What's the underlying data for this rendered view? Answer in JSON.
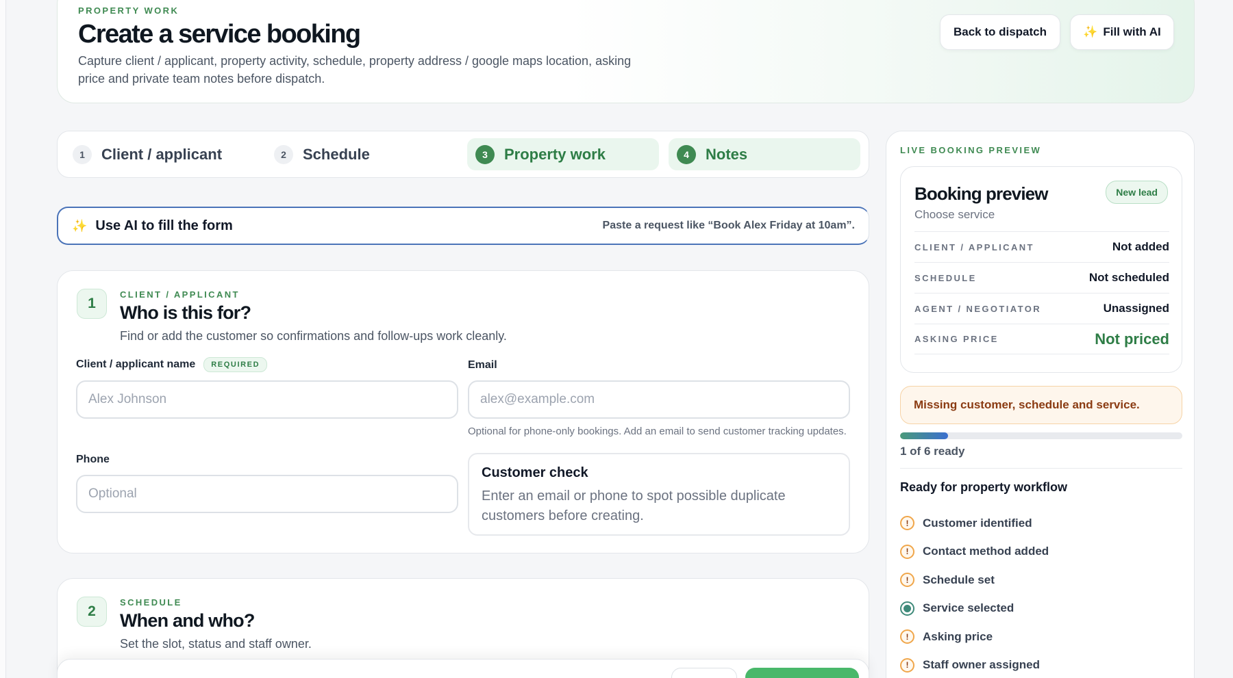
{
  "header": {
    "eyebrow": "PROPERTY WORK",
    "title": "Create a service booking",
    "description": "Capture client / applicant, property activity, schedule, property address / google maps location, asking price and private team notes before dispatch.",
    "back_label": "Back to dispatch",
    "ai_label": "Fill with AI"
  },
  "steps": [
    {
      "num": "1",
      "label": "Client / applicant",
      "active": false
    },
    {
      "num": "2",
      "label": "Schedule",
      "active": false
    },
    {
      "num": "3",
      "label": "Property work",
      "active": true
    },
    {
      "num": "4",
      "label": "Notes",
      "active": true
    }
  ],
  "ai_bar": {
    "title": "Use AI to fill the form",
    "hint": "Paste a request like “Book Alex Friday at 10am”."
  },
  "section1": {
    "num": "1",
    "eyebrow": "CLIENT / APPLICANT",
    "title": "Who is this for?",
    "subtitle": "Find or add the customer so confirmations and follow-ups work cleanly.",
    "name_label": "Client / applicant name",
    "required_label": "REQUIRED",
    "name_placeholder": "Alex Johnson",
    "email_label": "Email",
    "email_placeholder": "alex@example.com",
    "email_help": "Optional for phone-only bookings. Add an email to send customer tracking updates.",
    "phone_label": "Phone",
    "phone_placeholder": "Optional",
    "check_title": "Customer check",
    "check_desc": "Enter an email or phone to spot possible duplicate customers before creating."
  },
  "section2": {
    "num": "2",
    "eyebrow": "SCHEDULE",
    "title": "When and who?",
    "subtitle": "Set the slot, status and staff owner."
  },
  "sidebar": {
    "eyebrow": "LIVE BOOKING PREVIEW",
    "preview_title": "Booking preview",
    "preview_sub": "Choose service",
    "badge": "New lead",
    "rows": [
      {
        "key": "CLIENT / APPLICANT",
        "value": "Not added"
      },
      {
        "key": "SCHEDULE",
        "value": "Not scheduled"
      },
      {
        "key": "AGENT / NEGOTIATOR",
        "value": "Unassigned"
      },
      {
        "key": "ASKING PRICE",
        "value": "Not priced"
      }
    ],
    "warning": "Missing customer, schedule and service.",
    "progress": 0.17,
    "ready_text": "1 of 6 ready",
    "workflow_title": "Ready for property workflow",
    "checklist": [
      {
        "label": "Customer identified",
        "done": false
      },
      {
        "label": "Contact method added",
        "done": false
      },
      {
        "label": "Schedule set",
        "done": false
      },
      {
        "label": "Service selected",
        "done": true
      },
      {
        "label": "Asking price",
        "done": false
      },
      {
        "label": "Staff owner assigned",
        "done": false
      }
    ]
  },
  "colors": {
    "accent": "#3f8a52",
    "warning_bg": "#fef6ec",
    "warning_text": "#8a3b12",
    "focus": "#4a73b8"
  }
}
